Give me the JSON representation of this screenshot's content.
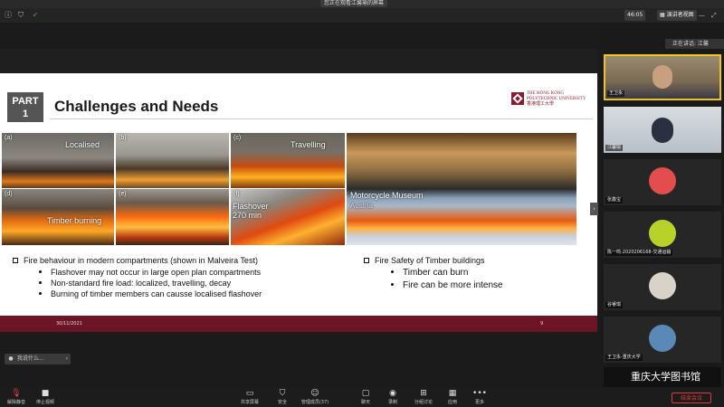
{
  "window": {
    "title": "您正在观看江馨瑜的屏幕"
  },
  "topbar": {
    "timer": "46:05",
    "view_option": "演讲者视图"
  },
  "slide": {
    "part_label": "PART",
    "part_number": "1",
    "title": "Challenges and Needs",
    "logo_en": "THE HONG KONG POLYTECHNIC UNIVERSITY",
    "logo_cn": "香港理工大學",
    "photos": [
      {
        "tag": "(a)",
        "label": "Localised"
      },
      {
        "tag": "(b)",
        "label": ""
      },
      {
        "tag": "(c)",
        "label": "Travelling"
      },
      {
        "tag": "(d)",
        "label": "Timber burning"
      },
      {
        "tag": "(e)",
        "label": ""
      },
      {
        "tag": "(f)",
        "label": "Flashover\n270 min"
      },
      {
        "tag": "",
        "label": "Motorcycle Museum",
        "sublabel": "Austria"
      }
    ],
    "left_bullets": {
      "head": "Fire behaviour in modern compartments (shown in Malveira Test)",
      "items": [
        "Flashover may not occur in large open plan compartments",
        "Non-standard fire load: localized, travelling, decay",
        "Burning of timber members can causse localised flashover"
      ]
    },
    "right_bullets": {
      "head": "Fire Safety of Timber buildings",
      "items": [
        "Timber can burn",
        "Fire can be more intense"
      ]
    },
    "footer_date": "30/11/2021",
    "footer_page": "9"
  },
  "chat_pill": "我说什么...",
  "panel": {
    "speaking": "正在讲话: 江馨",
    "participants": [
      {
        "name": "王卫永",
        "kind": "video"
      },
      {
        "name": "江馨瑜",
        "kind": "video"
      },
      {
        "name": "张鑫宝",
        "kind": "avatar",
        "color": "#e44d4d"
      },
      {
        "name": "陈一鸣-2020206168-交通运输",
        "kind": "avatar",
        "color": "#b9d22a"
      },
      {
        "name": "谷睿琪",
        "kind": "avatar",
        "color": "#d8d2c8"
      },
      {
        "name": "王卫永-重庆大学",
        "kind": "avatar",
        "color": "#5a89b8"
      }
    ],
    "library_label": "重庆大学图书馆"
  },
  "bottombar": {
    "items": [
      {
        "icon": "mic",
        "label": "解除静音"
      },
      {
        "icon": "video",
        "label": "停止视频"
      },
      {
        "icon": "share",
        "label": "共享屏幕"
      },
      {
        "icon": "security",
        "label": "安全"
      },
      {
        "icon": "participants",
        "label": "管理成员(37)"
      },
      {
        "icon": "chat",
        "label": "聊天"
      },
      {
        "icon": "record",
        "label": "录制"
      },
      {
        "icon": "breakout",
        "label": "分组讨论"
      },
      {
        "icon": "apps",
        "label": "应用"
      },
      {
        "icon": "more",
        "label": "更多"
      }
    ],
    "end_label": "结束会议"
  }
}
